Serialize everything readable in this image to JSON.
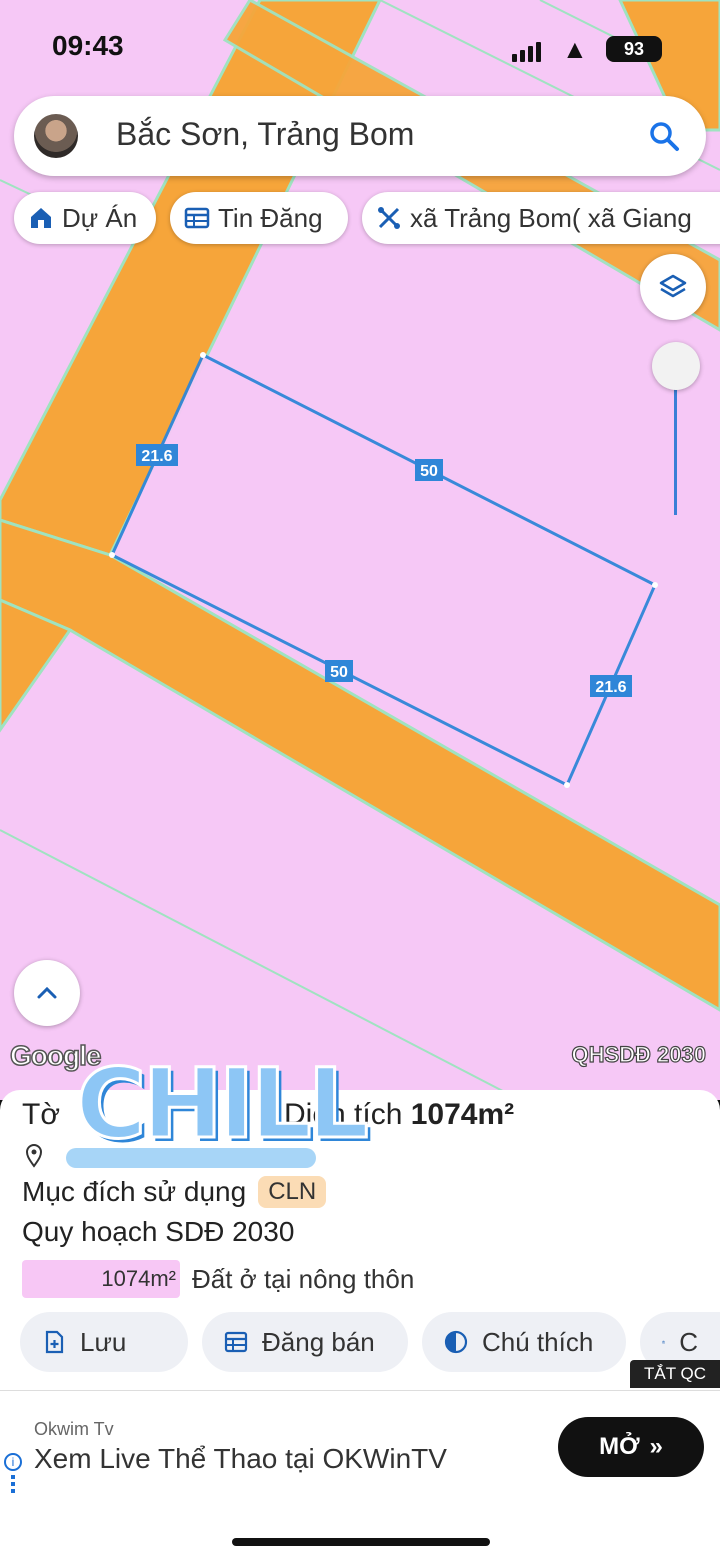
{
  "status_bar": {
    "time": "09:43",
    "battery": "93"
  },
  "search": {
    "query": "Bắc Sơn, Trảng Bom"
  },
  "chips": [
    {
      "label": "Dự Án"
    },
    {
      "label": "Tin Đăng"
    },
    {
      "label": "xã Trảng Bom( xã Giang"
    }
  ],
  "map": {
    "edge_labels": [
      "21.6",
      "50",
      "50",
      "21.6"
    ],
    "attribution": "Google",
    "plan_tag": "QHSDĐ 2030",
    "colors": {
      "land": "#f6c8f6",
      "road": "#f6a53a",
      "boundary": "#2f86d8"
    }
  },
  "parcel": {
    "sheet_label": "Tờ",
    "area_label": "Diện tích",
    "area_value": "1074m²",
    "usage_label": "Mục đích sử dụng",
    "usage_code": "CLN",
    "plan_label": "Quy hoạch SDĐ 2030",
    "legend_area": "1074m²",
    "legend_desc": "Đất ở tại nông thôn"
  },
  "actions": [
    {
      "label": "Lưu",
      "icon": "add-file-icon"
    },
    {
      "label": "Đăng bán",
      "icon": "table-icon"
    },
    {
      "label": "Chú thích",
      "icon": "half-circle-icon"
    },
    {
      "label": "C",
      "icon": "camera-icon"
    }
  ],
  "hide_ad_label": "TẮT QC",
  "ad": {
    "brand": "Okwim Tv",
    "headline": "Xem Live Thể Thao tại OKWinTV",
    "button": "MỞ",
    "button_arrow": "»"
  },
  "watermark": "CHILL"
}
